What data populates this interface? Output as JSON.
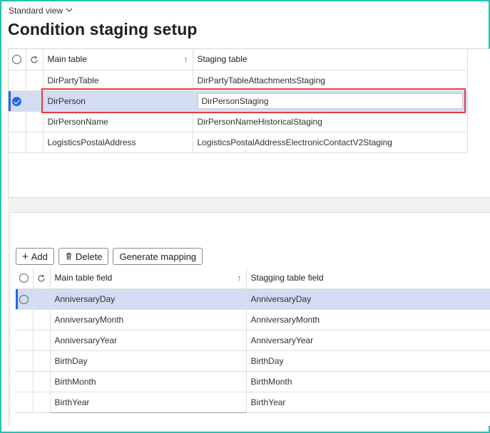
{
  "header": {
    "view_label": "Standard view",
    "title": "Condition staging setup"
  },
  "grid1": {
    "columns": {
      "main_table": "Main table",
      "staging_table": "Staging table"
    },
    "rows": [
      {
        "main": "DirPartyTable",
        "staging": "DirPartyTableAttachmentsStaging",
        "selected": false
      },
      {
        "main": "DirPerson",
        "staging": "DirPersonStaging",
        "selected": true
      },
      {
        "main": "DirPersonName",
        "staging": "DirPersonNameHistoricalStaging",
        "selected": false
      },
      {
        "main": "LogisticsPostalAddress",
        "staging": "LogisticsPostalAddressElectronicContactV2Staging",
        "selected": false
      }
    ]
  },
  "toolbar": {
    "add_label": "Add",
    "delete_label": "Delete",
    "generate_label": "Generate mapping"
  },
  "grid2": {
    "columns": {
      "main_field": "Main table field",
      "staging_field": "Stagging table field"
    },
    "rows": [
      {
        "main": "AnniversaryDay",
        "staging": "AnniversaryDay"
      },
      {
        "main": "AnniversaryMonth",
        "staging": "AnniversaryMonth"
      },
      {
        "main": "AnniversaryYear",
        "staging": "AnniversaryYear"
      },
      {
        "main": "BirthDay",
        "staging": "BirthDay"
      },
      {
        "main": "BirthMonth",
        "staging": "BirthMonth"
      },
      {
        "main": "BirthYear",
        "staging": "BirthYear"
      }
    ]
  },
  "colors": {
    "frame_border": "#28c0b5",
    "selected_row": "#d3dcf3",
    "accent": "#2266e3",
    "highlight_box": "#e04040"
  },
  "icons": [
    "chevron-down-icon",
    "refresh-icon",
    "sort-up-icon",
    "plus-icon",
    "trash-icon",
    "checkmark-icon"
  ]
}
